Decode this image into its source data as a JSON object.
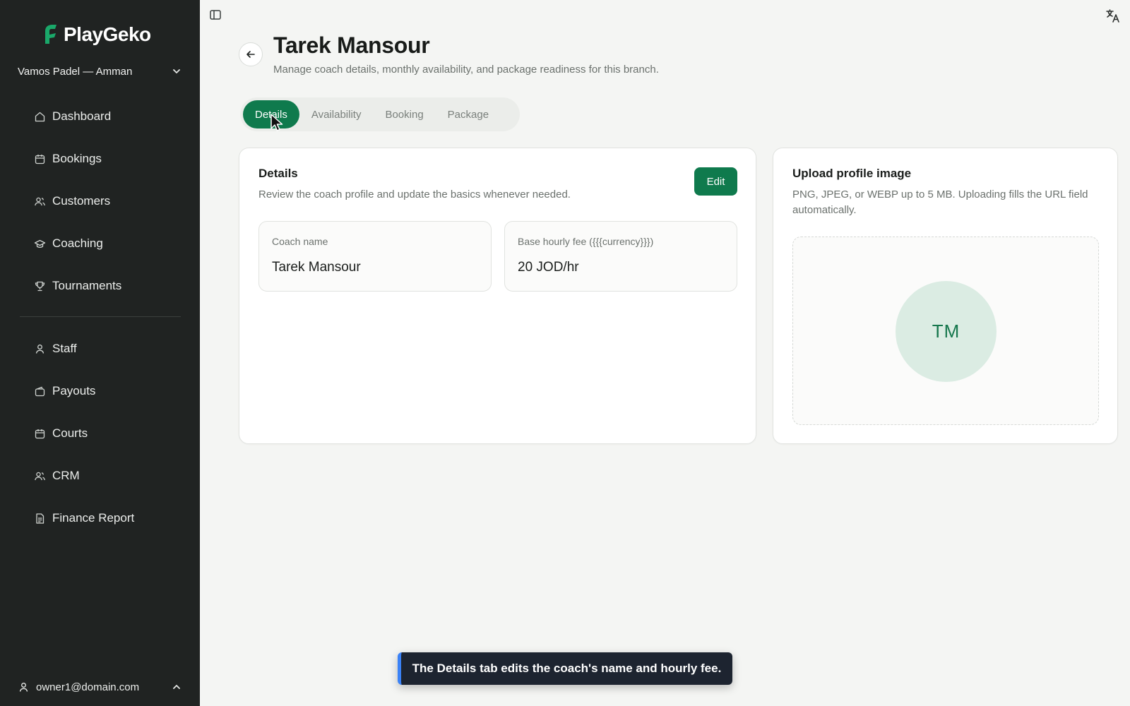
{
  "app": {
    "brand": "PlayGeko",
    "branch": "Vamos Padel — Amman",
    "accent": "#0f7a4d"
  },
  "sidebar": {
    "items": [
      {
        "label": "Dashboard",
        "icon": "home-icon"
      },
      {
        "label": "Bookings",
        "icon": "calendar-icon"
      },
      {
        "label": "Customers",
        "icon": "users-icon"
      },
      {
        "label": "Coaching",
        "icon": "graduation-cap-icon"
      },
      {
        "label": "Tournaments",
        "icon": "trophy-icon"
      },
      {
        "label": "Staff",
        "icon": "user-icon"
      },
      {
        "label": "Payouts",
        "icon": "wallet-icon"
      },
      {
        "label": "Courts",
        "icon": "calendar-icon"
      },
      {
        "label": "CRM",
        "icon": "users-icon"
      },
      {
        "label": "Finance Report",
        "icon": "document-icon"
      }
    ],
    "user_email": "owner1@domain.com"
  },
  "header": {
    "title": "Tarek Mansour",
    "subtitle": "Manage coach details, monthly availability, and package readiness for this branch."
  },
  "tabs": [
    {
      "label": "Details",
      "active": true
    },
    {
      "label": "Availability",
      "active": false
    },
    {
      "label": "Booking",
      "active": false
    },
    {
      "label": "Package",
      "active": false
    }
  ],
  "details_card": {
    "title": "Details",
    "description": "Review the coach profile and update the basics whenever needed.",
    "edit_label": "Edit",
    "fields": [
      {
        "label": "Coach name",
        "value": "Tarek Mansour"
      },
      {
        "label": "Base hourly fee ({{{currency}}})",
        "value": "20 JOD/hr"
      }
    ]
  },
  "upload_card": {
    "title": "Upload profile image",
    "description": "PNG, JPEG, or WEBP up to 5 MB. Uploading fills the URL field automatically.",
    "avatar_initials": "TM"
  },
  "toast": {
    "message": "The Details tab edits the coach's name and hourly fee."
  }
}
